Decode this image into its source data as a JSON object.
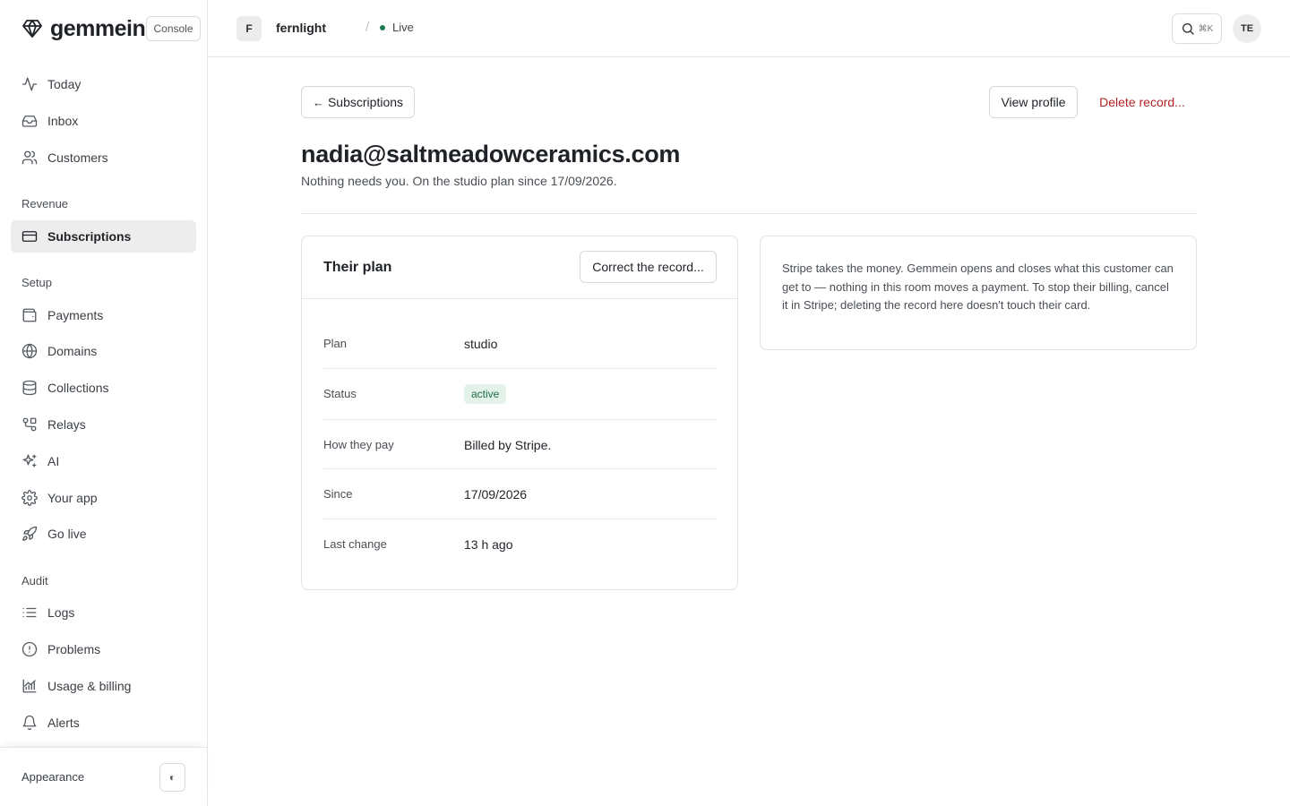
{
  "app": {
    "brand": "gemmein",
    "console_badge": "Console"
  },
  "sidebar": {
    "primary": [
      {
        "label": "Today",
        "icon": "activity-icon"
      },
      {
        "label": "Inbox",
        "icon": "inbox-icon"
      },
      {
        "label": "Customers",
        "icon": "users-icon"
      }
    ],
    "revenue_label": "Revenue",
    "revenue": [
      {
        "label": "Subscriptions",
        "icon": "credit-card-icon",
        "active": true
      }
    ],
    "setup_label": "Setup",
    "setup": [
      {
        "label": "Payments",
        "icon": "wallet-icon"
      },
      {
        "label": "Domains",
        "icon": "globe-icon"
      },
      {
        "label": "Collections",
        "icon": "database-icon"
      },
      {
        "label": "Relays",
        "icon": "route-icon"
      },
      {
        "label": "AI",
        "icon": "sparkles-icon"
      },
      {
        "label": "Your app",
        "icon": "gear-icon"
      },
      {
        "label": "Go live",
        "icon": "rocket-icon"
      }
    ],
    "audit_label": "Audit",
    "audit": [
      {
        "label": "Logs",
        "icon": "list-icon"
      },
      {
        "label": "Problems",
        "icon": "alert-circle-icon"
      },
      {
        "label": "Usage & billing",
        "icon": "chart-icon"
      },
      {
        "label": "Alerts",
        "icon": "bell-icon"
      }
    ],
    "footer": {
      "appearance_label": "Appearance",
      "toggle_glyph": "◐"
    }
  },
  "topbar": {
    "org_initial": "F",
    "org_name": "fernlight",
    "separator": "/",
    "env_label": "Live",
    "search_shortcut": "⌘K",
    "user_initials": "TE"
  },
  "page": {
    "back_label": "Subscriptions",
    "back_arrow": "←",
    "view_profile_label": "View profile",
    "delete_label": "Delete record...",
    "title": "nadia@saltmeadowceramics.com",
    "subtitle": "Nothing needs you. On the studio plan since 17/09/2026."
  },
  "plan_card": {
    "title": "Their plan",
    "correct_label": "Correct the record...",
    "rows": [
      {
        "key": "Plan",
        "value": "studio"
      },
      {
        "key": "Status",
        "value": "active"
      },
      {
        "key": "How they pay",
        "value": "Billed by Stripe."
      },
      {
        "key": "Since",
        "value": "17/09/2026"
      },
      {
        "key": "Last change",
        "value": "13 h ago"
      }
    ]
  },
  "info_card": {
    "text": "Stripe takes the money. Gemmein opens and closes what this customer can get to — nothing in this room moves a payment. To stop their billing, cancel it in Stripe; deleting the record here doesn't touch their card."
  },
  "colors": {
    "accent_live": "#1e7a52",
    "danger": "#b42323",
    "active_badge_bg": "#e4f3ea",
    "active_badge_text": "#1f6b44"
  }
}
